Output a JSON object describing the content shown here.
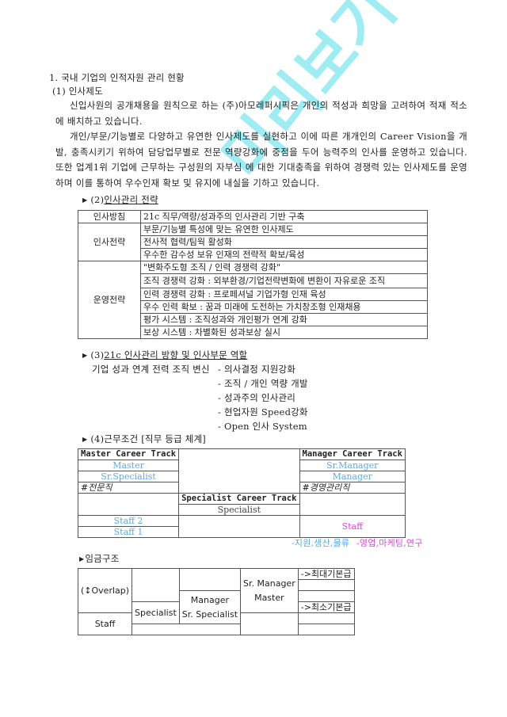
{
  "section": {
    "title": "1. 국내 기업의 인적자원 관리 현황",
    "sub1": "(1) 인사제도",
    "para1": "신입사원의 공개채용을 원칙으로 하는 (주)아모레퍼시픽은 개인의 적성과 희망을 고려하여 적재 적소에 배치하고 있습니다.",
    "para2": "개인/부문/기능별로 다양하고 유연한 인사제도를 실현하고 이에 따른 개개인의 Career Vision을 개발, 충족시키기 위하여 담당업무별로 전문 역량강화에 중점을 두어 능력주의 인사를 운영하고 있습니다. 또한 업계1위 기업에 근무하는 구성원의 자부심 에 대한 기대충족을 위하여 경쟁력 있는 인사제도를 운영하며 이를 통하여 우수인재 확보 및 유지에 내실을 기하고 있습니다."
  },
  "strategy": {
    "bullet": "▶",
    "prefix": "(2)",
    "title": "인사관리 전략",
    "rows": [
      {
        "category": "인사방침",
        "items": [
          "21c 직무/역량/성과주의 인사관리 기반 구축"
        ]
      },
      {
        "category": "인사전략",
        "items": [
          "부문/기능별 특성에 맞는 유연한 인사제도",
          "전사적 협력/팀웍 활성화",
          "우수한 감수성 보유 인재의 전략적 확보/육성"
        ]
      },
      {
        "category": "운영전략",
        "items": [
          "\"변화주도형 조직 / 인력 경쟁력 강화\"",
          "조직 경쟁력 강화 : 외부환경/기업전략변화에 변환이 자유로운 조직",
          "인력 경쟁력 강화 : 프로페셔널 기업가형 인재 육성",
          "우수 인력 확보 : 꿈과 미래에 도전하는 가치창조형 인재채용",
          "평가 시스템 : 조직성과와 개인평가 연계 강화",
          "보상 시스템 :  차별화된 성과보상 실시"
        ]
      }
    ]
  },
  "direction": {
    "bullet": "▶",
    "prefix": "(3)",
    "title": "21c 인사관리 방향 및 인사부문 역할",
    "lead": "기업 성과 연계 전력 조직 변신",
    "items": [
      "- 의사결정 지원강화",
      "- 조직 / 개인 역량 개발",
      "- 성과주의 인사관리",
      "- 현업자원 Speed강화",
      "- Open 인사 System"
    ]
  },
  "conditions": {
    "bullet": "▶",
    "title": "(4)근무조건 [직무 등급 체계]",
    "master_track": "Master Career Track",
    "manager_track": "Manager Career Track",
    "specialist_track": "Specialist Career Track",
    "master": "Master",
    "sr_specialist": "Sr.Specialist",
    "professional": "#전문직",
    "sr_manager": "Sr.Manager",
    "manager": "Manager",
    "management": "#경영관리직",
    "specialist": "Specialist",
    "staff2": "Staff 2",
    "staff1": "Staff 1",
    "staff": "Staff",
    "note_blue": "-지원,생산,물류",
    "note_pink": "-영업,마케팅,연구",
    "colors": {
      "blue": "#5aa9e6",
      "pink": "#e63ee6"
    }
  },
  "salary": {
    "bullet": "▶",
    "title": "임금구조",
    "overlap": "(↕Overlap)",
    "staff": "Staff",
    "specialist": "Specialist",
    "manager": "Manager",
    "sr_specialist": "Sr. Specialist",
    "sr_manager": "Sr. Manager",
    "master": "Master",
    "max_pay": "->최대기본급",
    "min_pay": "->최소기본급"
  },
  "watermark": "미리보기"
}
